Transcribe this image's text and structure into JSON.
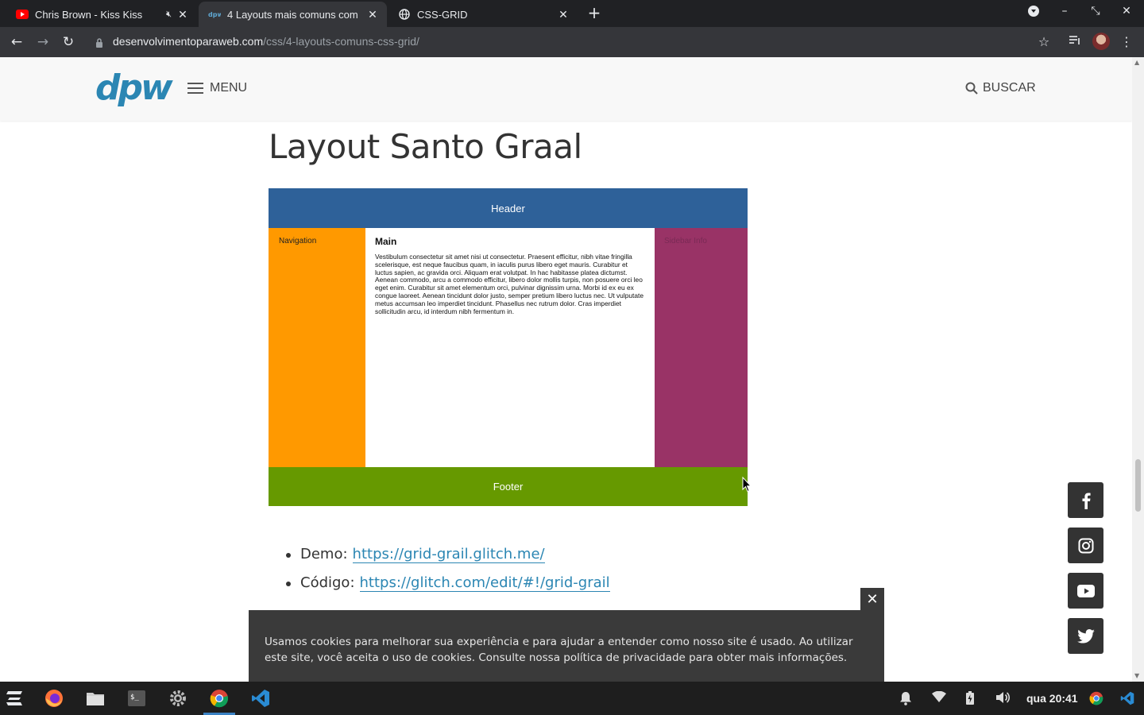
{
  "browser": {
    "tabs": [
      {
        "title": "Chris Brown - Kiss Kiss",
        "favicon": "youtube-icon",
        "muted": true
      },
      {
        "title": "4 Layouts mais comuns com",
        "favicon": "dpw-icon",
        "active": true
      },
      {
        "title": "CSS-GRID",
        "favicon": "globe-icon"
      }
    ],
    "url_host": "desenvolvimentoparaweb.com",
    "url_path": "/css/4-layouts-comuns-css-grid/"
  },
  "site": {
    "logo": "dpw",
    "menu_label": "MENU",
    "search_label": "BUSCAR",
    "brand_color": "#2b86b3"
  },
  "article": {
    "heading": "Layout Santo Graal",
    "figure": {
      "header": "Header",
      "navigation": "Navigation",
      "main_title": "Main",
      "main_text": "Vestibulum consectetur sit amet nisi ut consectetur. Praesent efficitur, nibh vitae fringilla scelerisque, est neque faucibus quam, in iaculis purus libero eget mauris. Curabitur et luctus sapien, ac gravida orci. Aliquam erat volutpat. In hac habitasse platea dictumst. Aenean commodo, arcu a commodo efficitur, libero dolor mollis turpis, non posuere orci leo eget enim. Curabitur sit amet elementum orci, pulvinar dignissim urna. Morbi id ex eu ex congue laoreet. Aenean tincidunt dolor justo, semper pretium libero luctus nec. Ut vulputate metus accumsan leo imperdiet tincidunt. Phasellus nec rutrum dolor. Cras imperdiet sollicitudin arcu, id interdum nibh fermentum in.",
      "sidebar": "Sidebar Info",
      "footer": "Footer",
      "colors": {
        "header": "#2e6199",
        "navigation": "#ff9900",
        "sidebar": "#993366",
        "footer": "#669900"
      }
    },
    "links": [
      {
        "label": "Demo:",
        "url": "https://grid-grail.glitch.me/"
      },
      {
        "label": "Código:",
        "url": "https://glitch.com/edit/#!/grid-grail"
      }
    ]
  },
  "social": [
    "facebook-icon",
    "instagram-icon",
    "youtube-icon",
    "twitter-icon"
  ],
  "cookie": {
    "text": "Usamos cookies para melhorar sua experiência e para ajudar a entender como nosso site é usado. Ao utilizar este site, você aceita o uso de cookies. Consulte nossa política de privacidade para obter mais informações.",
    "close": "✕"
  },
  "taskbar": {
    "clock": "qua 20:41"
  }
}
